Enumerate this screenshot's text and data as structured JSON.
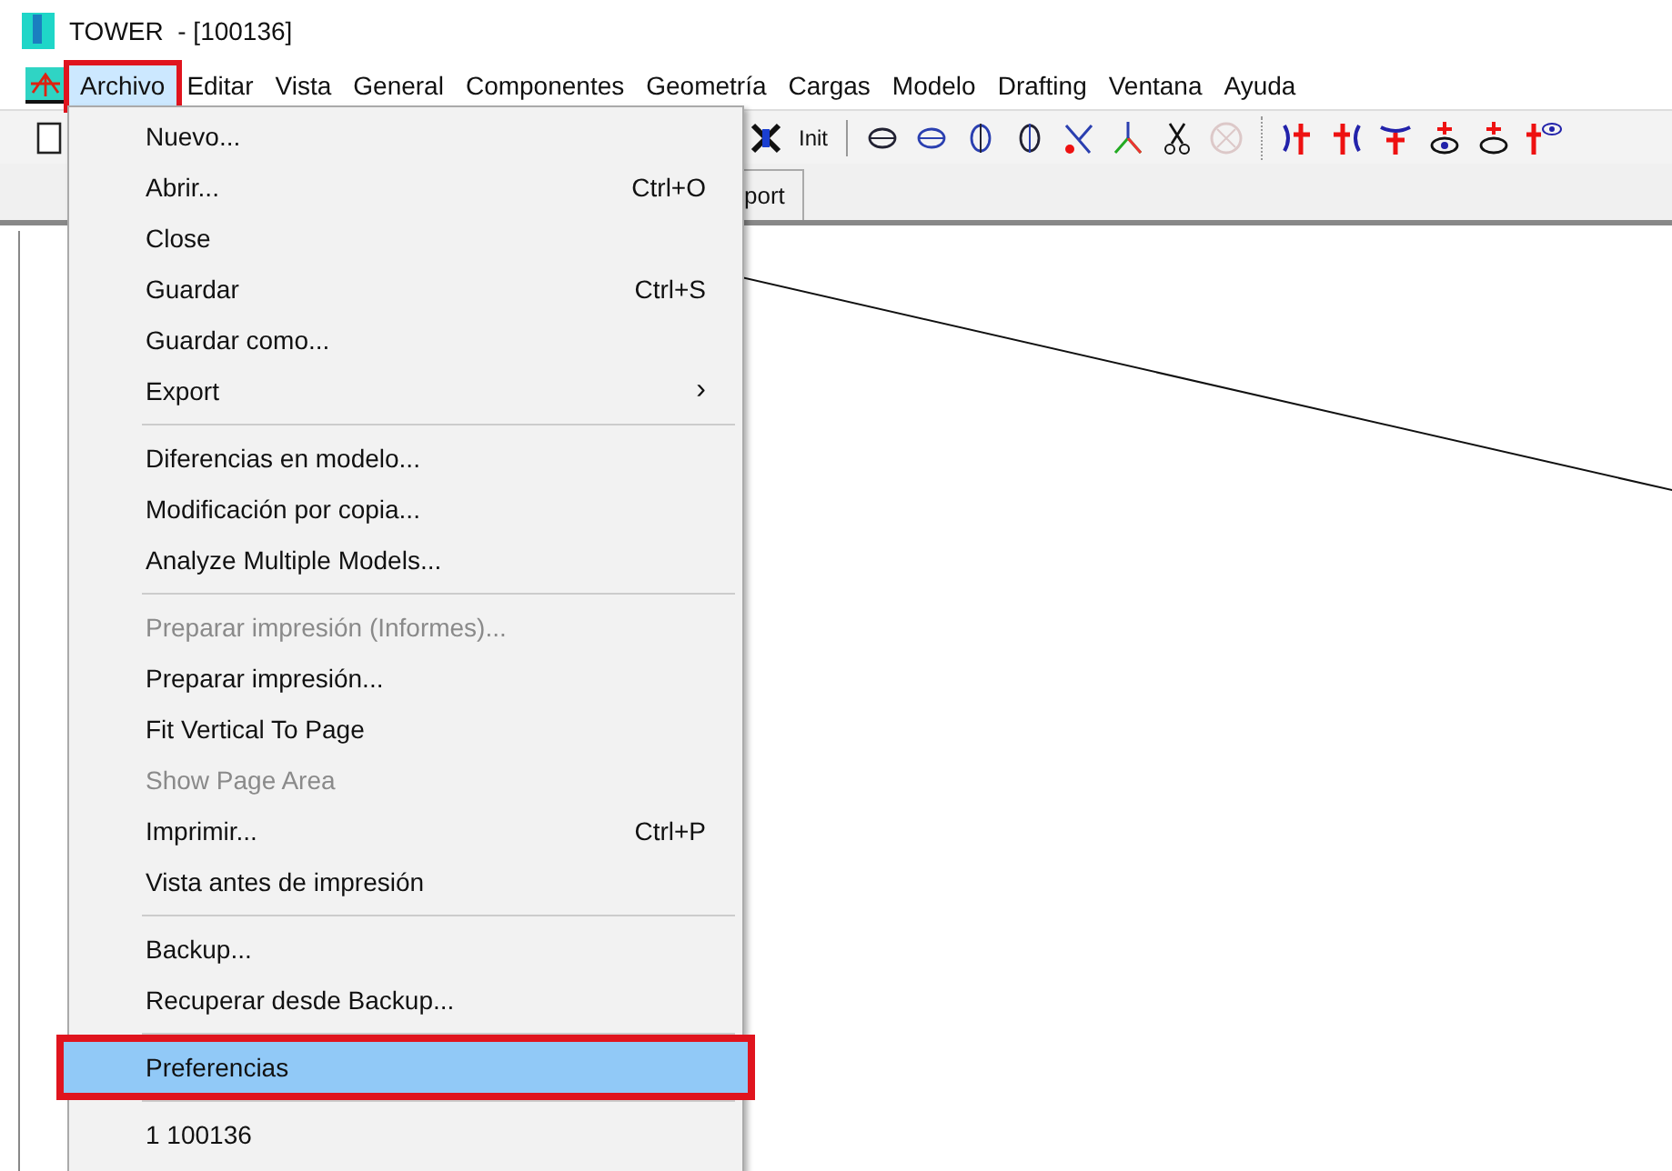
{
  "window": {
    "title": "TOWER  - [100136]"
  },
  "menubar": [
    {
      "label": "Archivo",
      "selected": true,
      "annotated": true
    },
    {
      "label": "Editar",
      "selected": false,
      "annotated": false
    },
    {
      "label": "Vista",
      "selected": false,
      "annotated": false
    },
    {
      "label": "General",
      "selected": false,
      "annotated": false
    },
    {
      "label": "Componentes",
      "selected": false,
      "annotated": false
    },
    {
      "label": "Geometría",
      "selected": false,
      "annotated": false
    },
    {
      "label": "Cargas",
      "selected": false,
      "annotated": false
    },
    {
      "label": "Modelo",
      "selected": false,
      "annotated": false
    },
    {
      "label": "Drafting",
      "selected": false,
      "annotated": false
    },
    {
      "label": "Ventana",
      "selected": false,
      "annotated": false
    },
    {
      "label": "Ayuda",
      "selected": false,
      "annotated": false
    }
  ],
  "toolbar": {
    "init_label": "Init"
  },
  "tab": {
    "label": "port"
  },
  "menu": [
    {
      "kind": "item",
      "label": "Nuevo...",
      "disabled": false,
      "selected": false,
      "annotated": false
    },
    {
      "kind": "item",
      "label": "Abrir...",
      "shortcut": "Ctrl+O",
      "disabled": false,
      "selected": false,
      "annotated": false
    },
    {
      "kind": "item",
      "label": "Close",
      "disabled": false,
      "selected": false,
      "annotated": false
    },
    {
      "kind": "item",
      "label": "Guardar",
      "shortcut": "Ctrl+S",
      "disabled": false,
      "selected": false,
      "annotated": false
    },
    {
      "kind": "item",
      "label": "Guardar como...",
      "disabled": false,
      "selected": false,
      "annotated": false
    },
    {
      "kind": "item",
      "label": "Export",
      "submenu_arrow": "›",
      "disabled": false,
      "selected": false,
      "annotated": false
    },
    {
      "kind": "separator"
    },
    {
      "kind": "item",
      "label": "Diferencias en modelo...",
      "disabled": false,
      "selected": false,
      "annotated": false
    },
    {
      "kind": "item",
      "label": "Modificación por copia...",
      "disabled": false,
      "selected": false,
      "annotated": false
    },
    {
      "kind": "item",
      "label": "Analyze Multiple Models...",
      "disabled": false,
      "selected": false,
      "annotated": false
    },
    {
      "kind": "separator"
    },
    {
      "kind": "item",
      "label": "Preparar impresión (Informes)...",
      "disabled": true,
      "selected": false,
      "annotated": false
    },
    {
      "kind": "item",
      "label": "Preparar impresión...",
      "disabled": false,
      "selected": false,
      "annotated": false
    },
    {
      "kind": "item",
      "label": "Fit Vertical To Page",
      "disabled": false,
      "selected": false,
      "annotated": false
    },
    {
      "kind": "item",
      "label": "Show Page Area",
      "disabled": true,
      "selected": false,
      "annotated": false
    },
    {
      "kind": "item",
      "label": "Imprimir...",
      "shortcut": "Ctrl+P",
      "disabled": false,
      "selected": false,
      "annotated": false
    },
    {
      "kind": "item",
      "label": "Vista antes de impresión",
      "disabled": false,
      "selected": false,
      "annotated": false
    },
    {
      "kind": "separator"
    },
    {
      "kind": "item",
      "label": "Backup...",
      "disabled": false,
      "selected": false,
      "annotated": false
    },
    {
      "kind": "item",
      "label": "Recuperar desde Backup...",
      "disabled": false,
      "selected": false,
      "annotated": false
    },
    {
      "kind": "separator"
    },
    {
      "kind": "item",
      "label": "Preferencias",
      "disabled": false,
      "selected": true,
      "annotated": true
    },
    {
      "kind": "separator"
    },
    {
      "kind": "item",
      "label": "1 100136",
      "disabled": false,
      "selected": false,
      "annotated": false
    }
  ]
}
